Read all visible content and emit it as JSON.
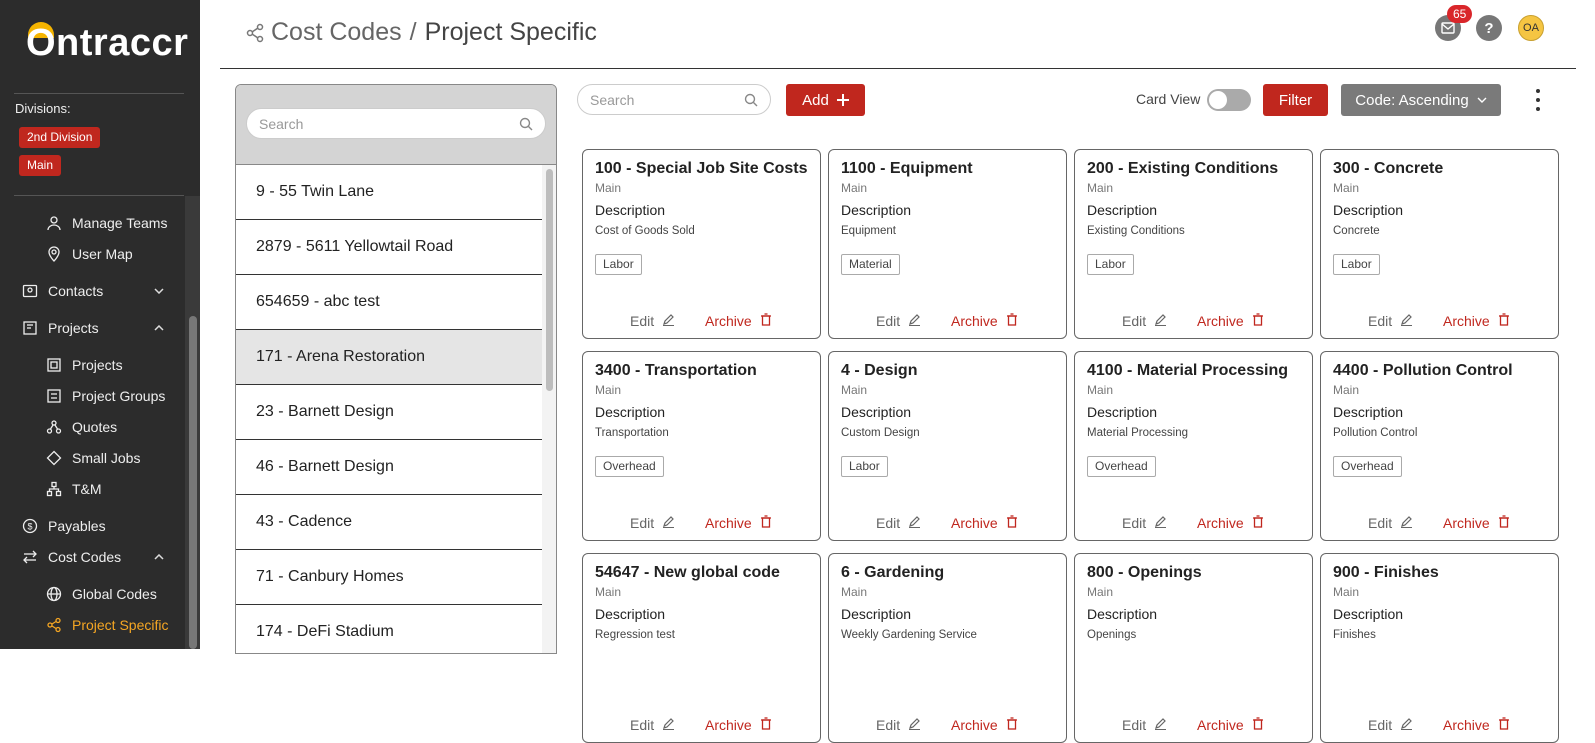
{
  "sidebar": {
    "logo": "Ontraccr",
    "divisions_label": "Divisions:",
    "divisions": [
      "2nd Division",
      "Main"
    ],
    "items": [
      {
        "label": "Manage Teams",
        "icon": "users-icon",
        "level": 2
      },
      {
        "label": "User Map",
        "icon": "map-pin-icon",
        "level": 2
      },
      {
        "label": "Contacts",
        "icon": "contacts-icon",
        "level": 1,
        "chevron": "down"
      },
      {
        "label": "Projects",
        "icon": "projects-icon",
        "level": 1,
        "chevron": "up"
      },
      {
        "label": "Projects",
        "icon": "project-icon",
        "level": 2
      },
      {
        "label": "Project Groups",
        "icon": "project-groups-icon",
        "level": 2
      },
      {
        "label": "Quotes",
        "icon": "quotes-icon",
        "level": 2
      },
      {
        "label": "Small Jobs",
        "icon": "small-jobs-icon",
        "level": 2
      },
      {
        "label": "T&M",
        "icon": "tm-icon",
        "level": 2
      },
      {
        "label": "Payables",
        "icon": "payables-icon",
        "level": 1
      },
      {
        "label": "Cost Codes",
        "icon": "cost-codes-icon",
        "level": 1,
        "chevron": "up"
      },
      {
        "label": "Global Codes",
        "icon": "globe-icon",
        "level": 2
      },
      {
        "label": "Project Specific",
        "icon": "share-icon",
        "level": 2,
        "active": true
      }
    ]
  },
  "header": {
    "section": "Cost Codes",
    "separator": "/",
    "page": "Project Specific",
    "notifications_count": "65",
    "avatar_initials": "OA"
  },
  "projects_panel": {
    "search_placeholder": "Search",
    "items": [
      "9 - 55 Twin Lane",
      "2879 - 5611 Yellowtail Road",
      "654659 - abc test",
      "171 - Arena Restoration",
      "23 - Barnett Design",
      "46 - Barnett Design",
      "43 - Cadence",
      "71 - Canbury Homes",
      "174 - DeFi Stadium"
    ],
    "selected_index": 3
  },
  "toolbar": {
    "search_placeholder": "Search",
    "add_label": "Add",
    "card_view_label": "Card View",
    "card_view_on": false,
    "filter_label": "Filter",
    "sort_label": "Code: Ascending"
  },
  "cards": [
    {
      "title": "100 - Special Job Site Costs",
      "division": "Main",
      "desc_label": "Description",
      "description": "Cost of Goods Sold",
      "tag": "Labor",
      "edit": "Edit",
      "archive": "Archive"
    },
    {
      "title": "1100 - Equipment",
      "division": "Main",
      "desc_label": "Description",
      "description": "Equipment",
      "tag": "Material",
      "edit": "Edit",
      "archive": "Archive"
    },
    {
      "title": "200 - Existing Conditions",
      "division": "Main",
      "desc_label": "Description",
      "description": "Existing Conditions",
      "tag": "Labor",
      "edit": "Edit",
      "archive": "Archive"
    },
    {
      "title": "300 - Concrete",
      "division": "Main",
      "desc_label": "Description",
      "description": "Concrete",
      "tag": "Labor",
      "edit": "Edit",
      "archive": "Archive"
    },
    {
      "title": "3400 - Transportation",
      "division": "Main",
      "desc_label": "Description",
      "description": "Transportation",
      "tag": "Overhead",
      "edit": "Edit",
      "archive": "Archive"
    },
    {
      "title": "4 - Design",
      "division": "Main",
      "desc_label": "Description",
      "description": "Custom Design",
      "tag": "Labor",
      "edit": "Edit",
      "archive": "Archive"
    },
    {
      "title": "4100 - Material Processing",
      "division": "Main",
      "desc_label": "Description",
      "description": "Material Processing",
      "tag": "Overhead",
      "edit": "Edit",
      "archive": "Archive"
    },
    {
      "title": "4400 - Pollution Control",
      "division": "Main",
      "desc_label": "Description",
      "description": "Pollution Control",
      "tag": "Overhead",
      "edit": "Edit",
      "archive": "Archive"
    },
    {
      "title": "54647 - New global code",
      "division": "Main",
      "desc_label": "Description",
      "description": "Regression test",
      "tag": "",
      "edit": "Edit",
      "archive": "Archive"
    },
    {
      "title": "6 - Gardening",
      "division": "Main",
      "desc_label": "Description",
      "description": "Weekly Gardening Service",
      "tag": "",
      "edit": "Edit",
      "archive": "Archive"
    },
    {
      "title": "800 - Openings",
      "division": "Main",
      "desc_label": "Description",
      "description": "Openings",
      "tag": "",
      "edit": "Edit",
      "archive": "Archive"
    },
    {
      "title": "900 - Finishes",
      "division": "Main",
      "desc_label": "Description",
      "description": "Finishes",
      "tag": "",
      "edit": "Edit",
      "archive": "Archive"
    }
  ],
  "colors": {
    "accent": "#c0271e",
    "active_nav": "#f5a623",
    "sidebar_bg": "#2c2c2c",
    "sort_button": "#7a7a7a"
  }
}
